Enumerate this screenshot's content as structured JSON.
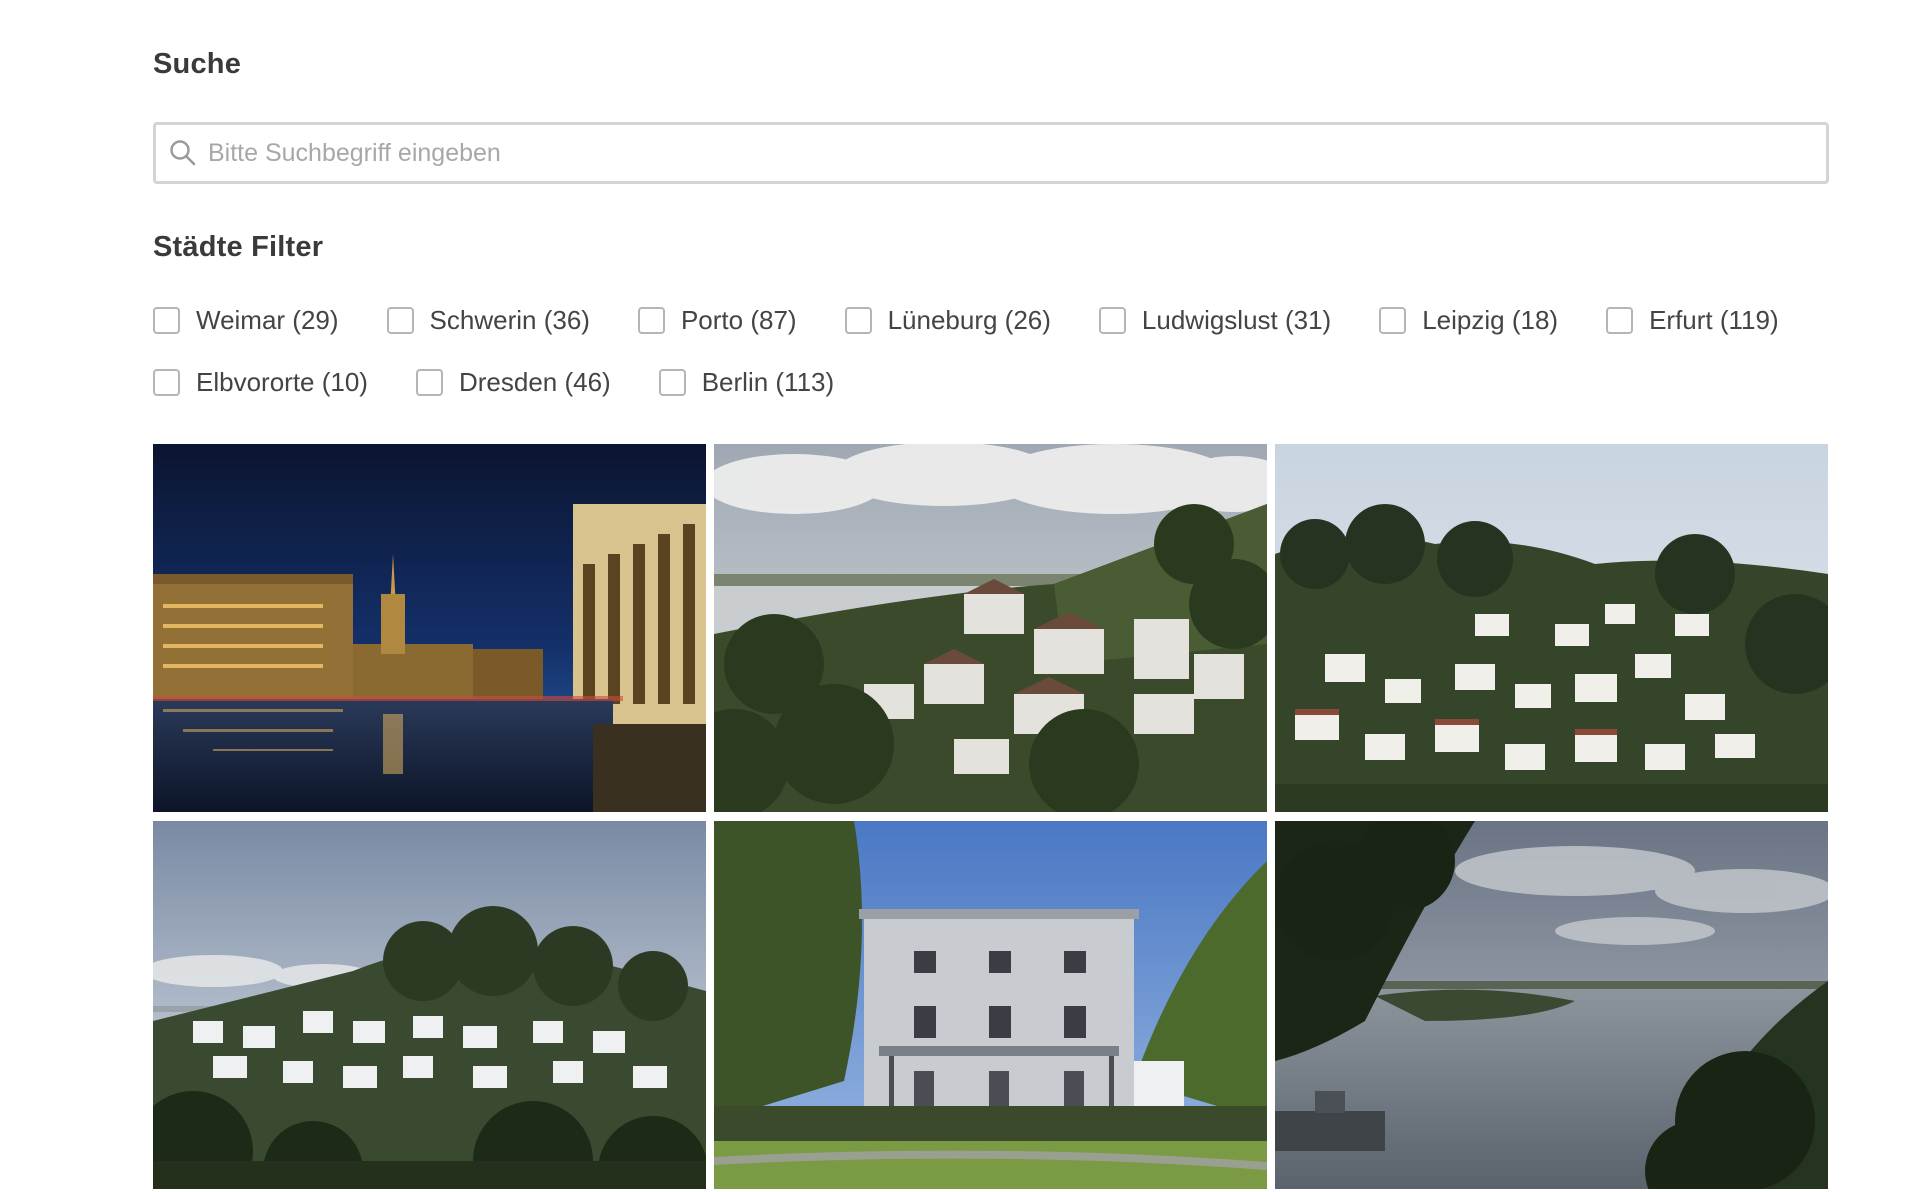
{
  "search": {
    "title": "Suche",
    "placeholder": "Bitte Suchbegriff eingeben",
    "value": "",
    "icon": "search-icon"
  },
  "filter": {
    "title": "Städte Filter",
    "rows": [
      [
        {
          "label": "Weimar (29)",
          "checked": false
        },
        {
          "label": "Schwerin (36)",
          "checked": false
        },
        {
          "label": "Porto (87)",
          "checked": false
        },
        {
          "label": "Lüneburg (26)",
          "checked": false
        },
        {
          "label": "Ludwigslust (31)",
          "checked": false
        },
        {
          "label": "Leipzig (18)",
          "checked": false
        },
        {
          "label": "Erfurt (119)",
          "checked": false
        }
      ],
      [
        {
          "label": "Elbvororte (10)",
          "checked": false
        },
        {
          "label": "Dresden (46)",
          "checked": false
        },
        {
          "label": "Berlin (113)",
          "checked": false
        }
      ]
    ]
  },
  "gallery": {
    "photos": [
      {
        "subject": "night city hall canal reflection"
      },
      {
        "subject": "hillside village with river and clouds"
      },
      {
        "subject": "dense hillside houses in trees"
      },
      {
        "subject": "hill with houses under evening sky"
      },
      {
        "subject": "classical villa in park"
      },
      {
        "subject": "river view with ship and trees"
      }
    ]
  }
}
